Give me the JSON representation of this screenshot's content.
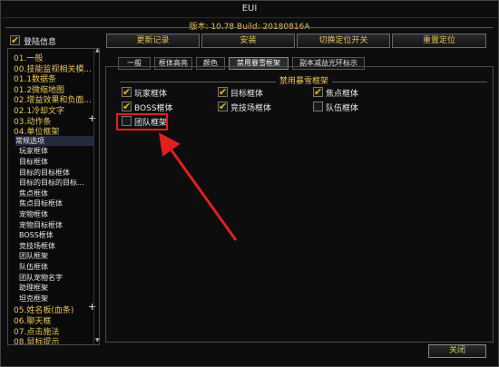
{
  "window": {
    "title": "EUI",
    "version_line": "版本: 10.78 Build: 20180816A"
  },
  "login_info": {
    "label": "登陆信息",
    "checked": true
  },
  "top_buttons": [
    "更新记录",
    "安装",
    "切换定位开关",
    "重置定位"
  ],
  "sidebar": {
    "items": [
      {
        "label": "01.一般",
        "type": "cat"
      },
      {
        "label": "00.技能监视相关模...",
        "type": "cat"
      },
      {
        "label": "01.1数据条",
        "type": "cat"
      },
      {
        "label": "01.2微缩地图",
        "type": "cat"
      },
      {
        "label": "02.增益效果和负面...",
        "type": "cat"
      },
      {
        "label": "02.1冷却文字",
        "type": "cat"
      },
      {
        "label": "03.动作条",
        "type": "cat",
        "plus": true
      },
      {
        "label": "04.单位框架",
        "type": "cat"
      },
      {
        "label": "常规选项",
        "type": "child",
        "selected": true
      },
      {
        "label": "玩家框体",
        "type": "child"
      },
      {
        "label": "目标框体",
        "type": "child"
      },
      {
        "label": "目标的目标框体",
        "type": "child"
      },
      {
        "label": "目标的目标的目标...",
        "type": "child"
      },
      {
        "label": "焦点框体",
        "type": "child"
      },
      {
        "label": "焦点目标框体",
        "type": "child"
      },
      {
        "label": "宠物框体",
        "type": "child"
      },
      {
        "label": "宠物目标框体",
        "type": "child"
      },
      {
        "label": "BOSS框体",
        "type": "child"
      },
      {
        "label": "竞技场框体",
        "type": "child"
      },
      {
        "label": "团队框架",
        "type": "child"
      },
      {
        "label": "队伍框体",
        "type": "child"
      },
      {
        "label": "团队宠物名字",
        "type": "child"
      },
      {
        "label": "助理框架",
        "type": "child"
      },
      {
        "label": "坦克框架",
        "type": "child"
      },
      {
        "label": "05.姓名板(血条)",
        "type": "cat",
        "plus": true
      },
      {
        "label": "06.聊天框",
        "type": "cat"
      },
      {
        "label": "07.点击施法",
        "type": "cat"
      },
      {
        "label": "08.鼠标提示",
        "type": "cat"
      }
    ]
  },
  "tabs": [
    {
      "label": "一般",
      "active": false
    },
    {
      "label": "框体高亮",
      "active": false
    },
    {
      "label": "颜色",
      "active": false
    },
    {
      "label": "禁用暴雪框架",
      "active": true
    },
    {
      "label": "副本减益光环标示",
      "active": false
    }
  ],
  "group": {
    "title": "禁用暴雪框架",
    "checkboxes": [
      {
        "label": "玩家框体",
        "checked": true
      },
      {
        "label": "目标框体",
        "checked": true
      },
      {
        "label": "焦点框体",
        "checked": true
      },
      {
        "label": "BOSS框体",
        "checked": true
      },
      {
        "label": "竞技场框体",
        "checked": true
      },
      {
        "label": "队伍框体",
        "checked": false
      },
      {
        "label": "团队框架",
        "checked": false
      }
    ]
  },
  "close_button": "关闭",
  "colors": {
    "accent": "#e6c45a",
    "annotation": "#e0201e"
  }
}
